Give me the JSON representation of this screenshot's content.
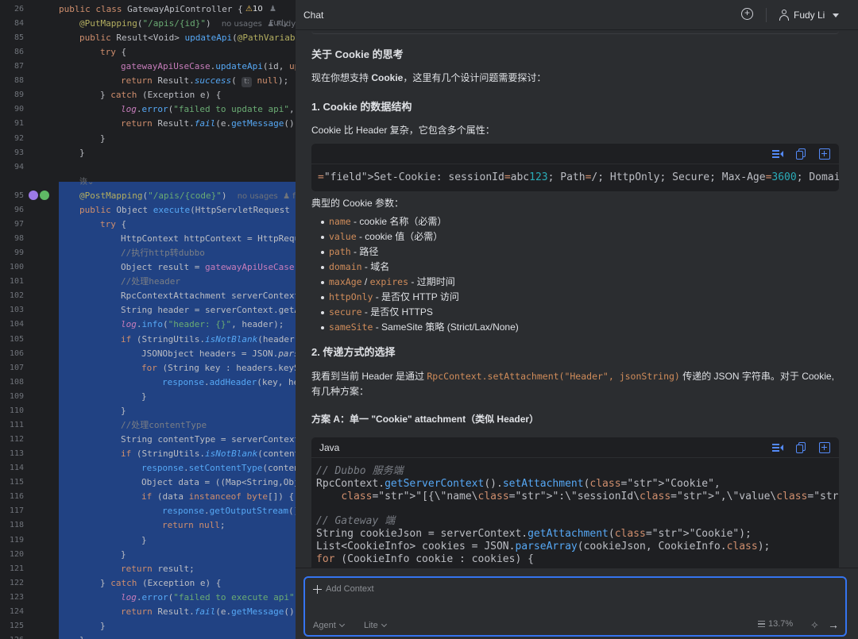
{
  "editor": {
    "class_line": {
      "ln": "26",
      "code_kw": "public class ",
      "code_name": "GatewayApiController {",
      "warn_count": "10",
      "hint": "Fudy"
    },
    "lines": [
      {
        "ln": "84",
        "html": "<span class=\"ann\">@PutMapping</span>(<span class=\"str\">\"/apis/{id}\"</span>)  <span class=\"hint\">no usages  </span><span class=\"hint\">♟ Fudy •</span>",
        "indent": 1
      },
      {
        "ln": "85",
        "html": "<span class=\"kw\">public</span> Result&lt;Void&gt; <span class=\"fn\">updateApi</span>(<span class=\"ann\">@PathVariabl</span>",
        "indent": 1
      },
      {
        "ln": "86",
        "html": "<span class=\"kw\">try</span> {",
        "indent": 2
      },
      {
        "ln": "87",
        "html": "<span class=\"field\">gatewayApiUseCase</span>.<span class=\"fn\">updateApi</span>(id, <span class=\"kw\">up</span>",
        "indent": 3
      },
      {
        "ln": "88",
        "html": "<span class=\"kw\">return</span> Result.<span class=\"fn it\">success</span>( <span class=\"hint-chip\">t:</span> <span class=\"kw\">null</span>);",
        "indent": 3
      },
      {
        "ln": "89",
        "html": "} <span class=\"kw\">catch</span> (Exception e) {",
        "indent": 2
      },
      {
        "ln": "90",
        "html": "<span class=\"field it\">log</span>.<span class=\"fn\">error</span>(<span class=\"str\">\"failed to update api\"</span>, e",
        "indent": 3
      },
      {
        "ln": "91",
        "html": "<span class=\"kw\">return</span> Result.<span class=\"fn it\">fail</span>(e.<span class=\"fn\">getMessage</span>())",
        "indent": 3
      },
      {
        "ln": "92",
        "html": "}",
        "indent": 2
      },
      {
        "ln": "93",
        "html": "}",
        "indent": 1
      },
      {
        "ln": "94",
        "html": "",
        "indent": 1
      },
      {
        "ln": "",
        "html": "<span class=\"hint\">诙⌄</span>",
        "indent": 1
      },
      {
        "ln": "95",
        "html": "<span class=\"ann\">@PostMapping</span>(<span class=\"str\">\"/apis/{code}\"</span>)  <span class=\"hint\">no usages  </span><span class=\"hint\">♟ fu</span>",
        "indent": 1,
        "sel": true,
        "icons": true
      },
      {
        "ln": "96",
        "html": "<span class=\"kw\">public</span> Object <span class=\"fn\">execute</span>(HttpServletRequest r",
        "indent": 1
      },
      {
        "ln": "97",
        "html": "<span class=\"kw\">try</span> {",
        "indent": 2
      },
      {
        "ln": "98",
        "html": "HttpContext httpContext = HttpRequ",
        "indent": 3
      },
      {
        "ln": "99",
        "html": "<span class=\"cm\">//执行http转dubbo</span>",
        "indent": 3
      },
      {
        "ln": "100",
        "html": "Object result = <span class=\"field\">gatewayApiUseCase</span>.",
        "indent": 3
      },
      {
        "ln": "101",
        "html": "<span class=\"cm\">//处理header</span>",
        "indent": 3
      },
      {
        "ln": "102",
        "html": "RpcContextAttachment serverContext",
        "indent": 3
      },
      {
        "ln": "103",
        "html": "String header = serverContext.getA",
        "indent": 3
      },
      {
        "ln": "104",
        "html": "<span class=\"field it\">log</span>.<span class=\"fn\">info</span>(<span class=\"str\">\"header: {}\"</span>, header);",
        "indent": 3
      },
      {
        "ln": "105",
        "html": "<span class=\"kw\">if</span> (StringUtils.<span class=\"fn it\">isNotBlank</span>(header)",
        "indent": 3
      },
      {
        "ln": "106",
        "html": "JSONObject headers = JSON.<span class=\"it\">pars</span>",
        "indent": 4
      },
      {
        "ln": "107",
        "html": "<span class=\"kw\">for</span> (String key : headers.keyS",
        "indent": 4
      },
      {
        "ln": "108",
        "html": "<span class=\"fn\">response</span>.<span class=\"fn\">addHeader</span>(key, he",
        "indent": 5
      },
      {
        "ln": "109",
        "html": "}",
        "indent": 4
      },
      {
        "ln": "110",
        "html": "}",
        "indent": 3
      },
      {
        "ln": "111",
        "html": "<span class=\"cm\">//处理contentType</span>",
        "indent": 3
      },
      {
        "ln": "112",
        "html": "String contentType = serverContext",
        "indent": 3
      },
      {
        "ln": "113",
        "html": "<span class=\"kw\">if</span> (StringUtils.<span class=\"fn it\">isNotBlank</span>(content",
        "indent": 3
      },
      {
        "ln": "114",
        "html": "<span class=\"fn\">response</span>.<span class=\"fn\">setContentType</span>(conten",
        "indent": 4
      },
      {
        "ln": "115",
        "html": "Object data = ((Map&lt;String,Obj",
        "indent": 4
      },
      {
        "ln": "116",
        "html": "<span class=\"kw\">if</span> (data <span class=\"kw\">instanceof byte</span>[]) {",
        "indent": 4
      },
      {
        "ln": "117",
        "html": "<span class=\"fn\">response</span>.<span class=\"fn\">getOutputStream</span>()",
        "indent": 5
      },
      {
        "ln": "118",
        "html": "<span class=\"kw\">return null</span>;",
        "indent": 5
      },
      {
        "ln": "119",
        "html": "}",
        "indent": 4
      },
      {
        "ln": "120",
        "html": "}",
        "indent": 3
      },
      {
        "ln": "121",
        "html": "<span class=\"kw\">return</span> result;",
        "indent": 3
      },
      {
        "ln": "122",
        "html": "} <span class=\"kw\">catch</span> (Exception e) {",
        "indent": 2
      },
      {
        "ln": "123",
        "html": "<span class=\"field it\">log</span>.<span class=\"fn\">error</span>(<span class=\"str\">\"failed to execute api\"</span>,",
        "indent": 3
      },
      {
        "ln": "124",
        "html": "<span class=\"kw\">return</span> Result.<span class=\"fn it\">fail</span>(e.<span class=\"fn\">getMessage</span>())",
        "indent": 3
      },
      {
        "ln": "125",
        "html": "}",
        "indent": 2
      },
      {
        "ln": "126",
        "html": "}",
        "indent": 1
      }
    ]
  },
  "chat": {
    "title": "Chat",
    "user_name": "Fudy Li",
    "section_title": "关于 Cookie 的思考",
    "intro_pre": "现在你想支持 ",
    "intro_bold": "Cookie",
    "intro_post": "，这里有几个设计问题需要探讨：",
    "h1": "1. Cookie 的数据结构",
    "p1": "Cookie 比 Header 复杂，它包含多个属性：",
    "code1": "Set-Cookie: sessionId=abc123; Path=/; HttpOnly; Secure; Max-Age=3600; Domain=.exam",
    "params_title": "典型的 Cookie 参数：",
    "params": [
      {
        "code": "name",
        "text": " - cookie 名称（必需）"
      },
      {
        "code": "value",
        "text": " - cookie 值（必需）"
      },
      {
        "code": "path",
        "text": " - 路径"
      },
      {
        "code": "domain",
        "text": " - 域名"
      },
      {
        "code": "maxAge",
        "code2": "expires",
        "sep": " / ",
        "text": " - 过期时间"
      },
      {
        "code": "httpOnly",
        "text": " - 是否仅 HTTP 访问"
      },
      {
        "code": "secure",
        "text": " - 是否仅 HTTPS"
      },
      {
        "code": "sameSite",
        "text": " - SameSite 策略 (Strict/Lax/None)"
      }
    ],
    "h2": "2. 传递方式的选择",
    "p2_pre": "我看到当前 Header 是通过 ",
    "p2_code": "RpcContext.setAttachment(\"Header\", jsonString)",
    "p2_post": " 传递的 JSON 字符串。对于 Cookie,",
    "p2_line2": "有几种方案：",
    "optA": "方案 A：单一 \"Cookie\" attachment（类似 Header）",
    "code2_lang": "Java",
    "code2_lines": [
      "// Dubbo 服务端",
      "RpcContext.getServerContext().setAttachment(\"Cookie\",",
      "    \"[{\\\"name\\\":\\\"sessionId\\\",\\\"value\\\":\\\"abc123\\\",\\\"httpOnly\\\":true,\\\"maxAge\\\":360",
      "",
      "// Gateway 端",
      "String cookieJson = serverContext.getAttachment(\"Cookie\");",
      "List<CookieInfo> cookies = JSON.parseArray(cookieJson, CookieInfo.class);",
      "for (CookieInfo cookie : cookies) {"
    ],
    "input": {
      "add_context": "Add Context",
      "agent": "Agent",
      "model": "Lite",
      "usage": "13.7%"
    }
  }
}
